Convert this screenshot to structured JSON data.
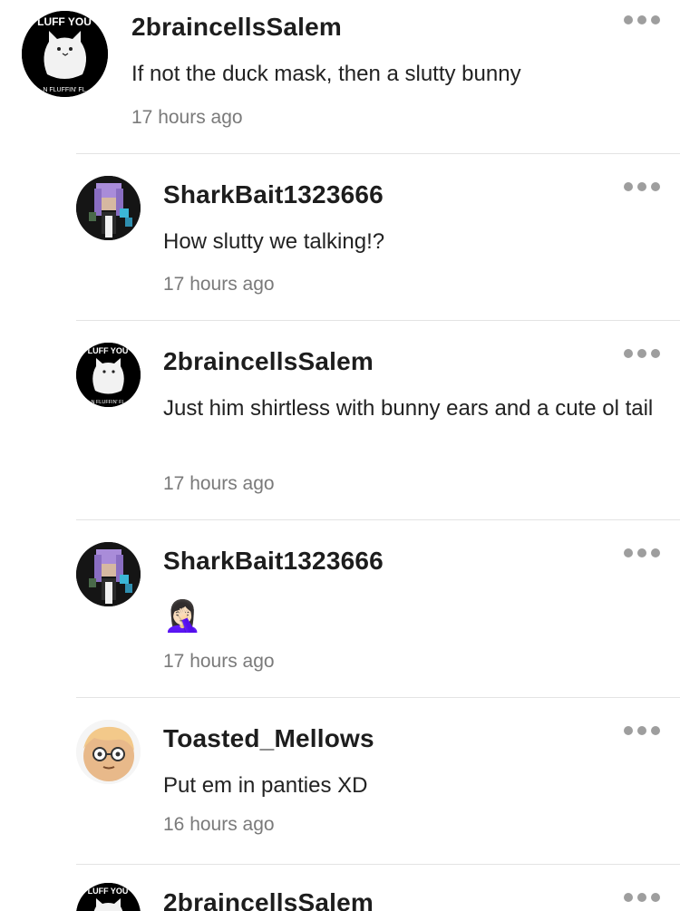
{
  "comments": [
    {
      "username": "2braincellsSalem",
      "text": "If not the duck mask, then a slutty bunny",
      "time": "17 hours ago",
      "avatar": "cat-avatar",
      "avatar_top_text": "LUFF YOU",
      "avatar_bottom_text": "N FLUFFIN' FL"
    },
    {
      "username": "SharkBait1323666",
      "text": "How slutty we talking!?",
      "time": "17 hours ago",
      "avatar": "pixel-character-avatar"
    },
    {
      "username": "2braincellsSalem",
      "text": "Just him shirtless with bunny ears and a cute ol tail",
      "time": "17 hours ago",
      "avatar": "cat-avatar",
      "avatar_top_text": "LUFF YOU",
      "avatar_bottom_text": "N FLUFFIN' FL"
    },
    {
      "username": "SharkBait1323666",
      "text": "🤦🏻‍♀️",
      "time": "17 hours ago",
      "avatar": "pixel-character-avatar"
    },
    {
      "username": "Toasted_Mellows",
      "text": "Put em in panties XD",
      "time": "16 hours ago",
      "avatar": "glasses-character-avatar"
    },
    {
      "username": "2braincellsSalem",
      "avatar": "cat-avatar",
      "avatar_top_text": "LUFF YOU"
    }
  ],
  "colors": {
    "username": "#1d1d1d",
    "timestamp": "#7a7a7a",
    "menu_dots": "#9e9e9e",
    "divider": "#e3e3e3"
  }
}
